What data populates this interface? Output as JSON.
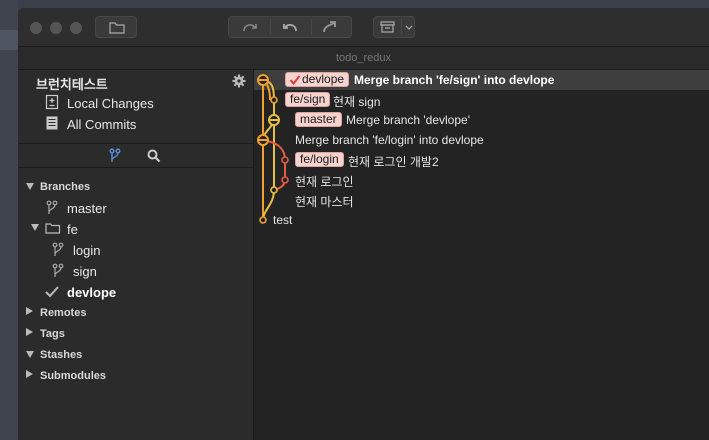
{
  "app": {
    "window_title": "todo_redux"
  },
  "sidebar": {
    "repo_name": "브런치테스트",
    "workspace": [
      {
        "label": "Local Changes",
        "icon": "local-changes-icon"
      },
      {
        "label": "All Commits",
        "icon": "all-commits-icon"
      }
    ],
    "sections": {
      "branches": "Branches",
      "remotes": "Remotes",
      "tags": "Tags",
      "stashes": "Stashes",
      "submodules": "Submodules"
    },
    "branches": {
      "master": "master",
      "folder_fe": "fe",
      "login": "login",
      "sign": "sign",
      "current": "devlope"
    }
  },
  "commits": [
    {
      "refs": [
        "devlope"
      ],
      "message": "Merge branch 'fe/sign' into devlope",
      "head": true
    },
    {
      "refs": [
        "fe/sign"
      ],
      "message": "현재 sign"
    },
    {
      "refs": [
        "master"
      ],
      "message": "Merge branch 'devlope'"
    },
    {
      "refs": [],
      "message": "Merge branch 'fe/login' into devlope"
    },
    {
      "refs": [
        "fe/login"
      ],
      "message": "현재 로그인 개발2"
    },
    {
      "refs": [],
      "message": "현재 로그인"
    },
    {
      "refs": [],
      "message": "현재 마스터"
    },
    {
      "refs": [],
      "message": "test"
    }
  ],
  "colors": {
    "graph_orange": "#f0a030",
    "graph_yellow": "#e8c040",
    "graph_red": "#e85c40",
    "ref_tag_bg": "#f6d3cf",
    "check_red": "#e03c3c"
  }
}
